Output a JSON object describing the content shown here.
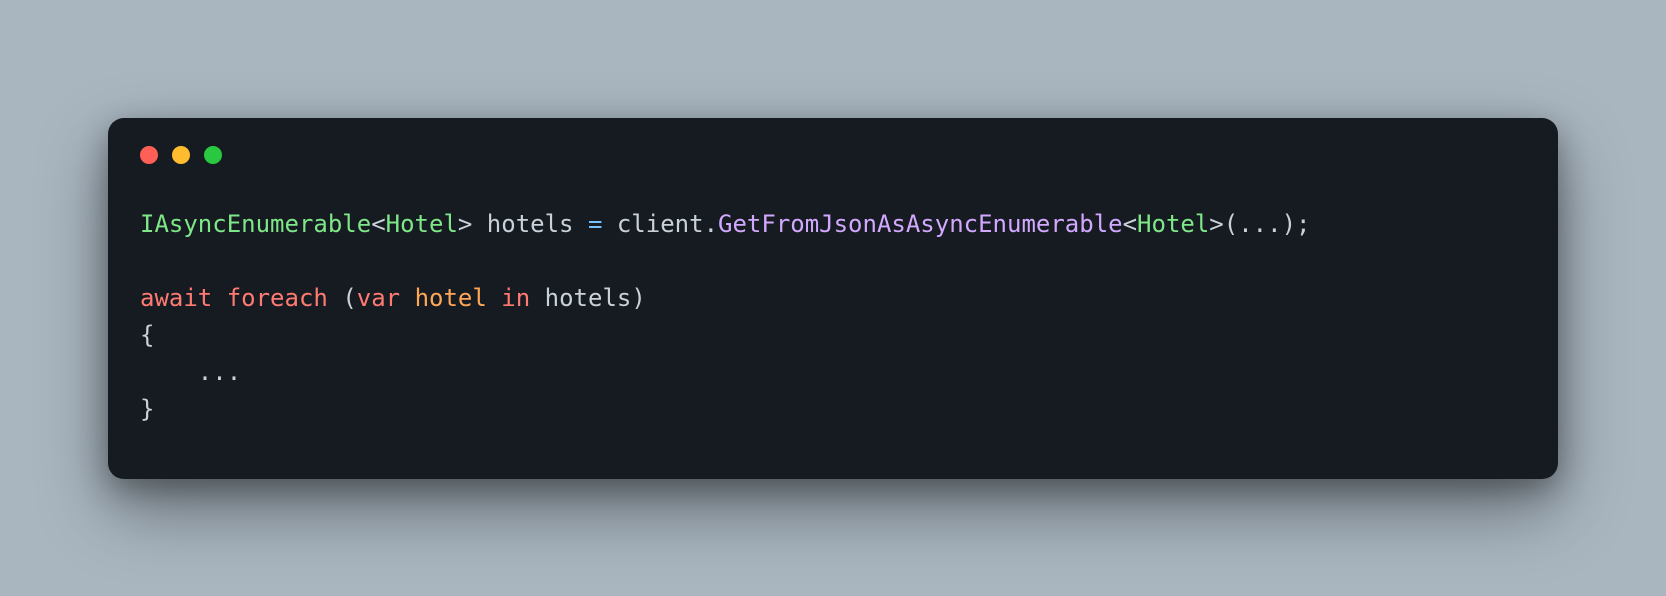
{
  "code": {
    "line1": {
      "type1": "IAsyncEnumerable",
      "open_angle": "<",
      "type2": "Hotel",
      "close_angle": ">",
      "space1": " ",
      "identifier1": "hotels",
      "space2": " ",
      "equals": "=",
      "space3": " ",
      "identifier2": "client",
      "dot": ".",
      "method": "GetFromJsonAsAsyncEnumerable",
      "open_angle2": "<",
      "type3": "Hotel",
      "close_angle2": ">",
      "paren_open": "(",
      "ellipsis": "...",
      "paren_close": ")",
      "semicolon": ";"
    },
    "line3": {
      "keyword1": "await",
      "space1": " ",
      "keyword2": "foreach",
      "space2": " ",
      "paren_open": "(",
      "var_kw": "var",
      "space3": " ",
      "identifier": "hotel",
      "space4": " ",
      "in_kw": "in",
      "space5": " ",
      "identifier2": "hotels",
      "paren_close": ")"
    },
    "line4": {
      "brace_open": "{"
    },
    "line5": {
      "indent": "    ",
      "ellipsis": "..."
    },
    "line6": {
      "brace_close": "}"
    }
  }
}
